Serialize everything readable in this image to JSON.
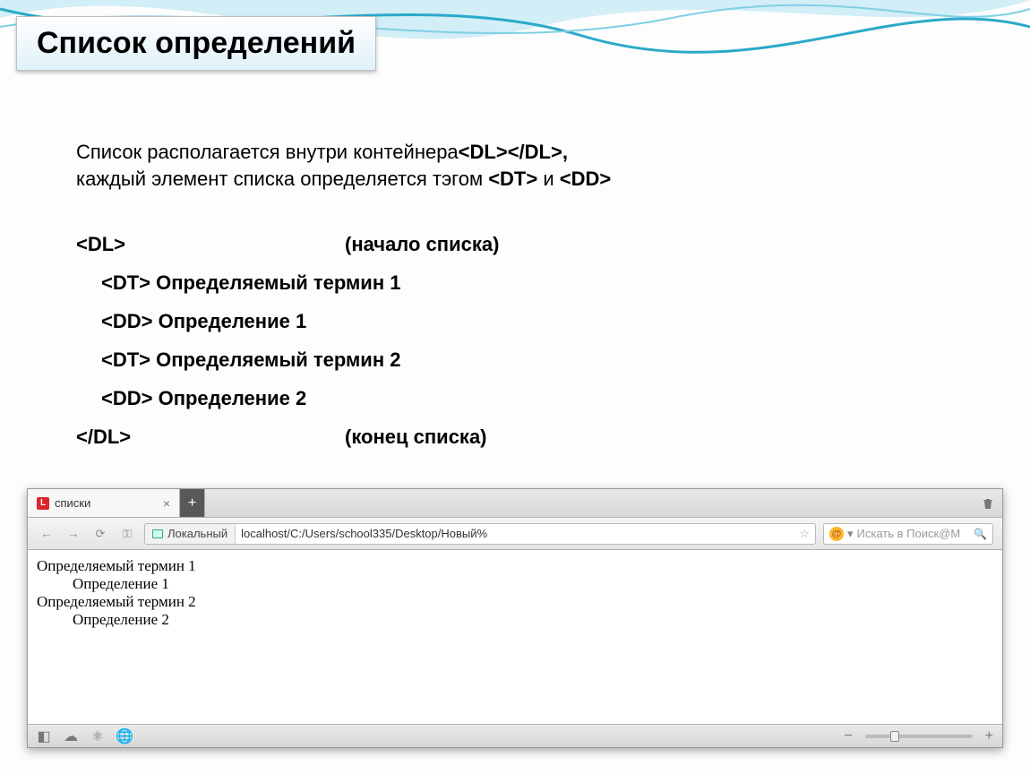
{
  "title": "Список определений",
  "intro": {
    "line1_a": "Список располагается внутри контейнера",
    "line1_b": "<DL></DL>,",
    "line2_a": "каждый элемент списка определяется тэгом ",
    "line2_b": "<DT>",
    "line2_c": " и ",
    "line2_d": "<DD>"
  },
  "code": {
    "r1a": "<DL>",
    "r1b": "(начало списка)",
    "r2": "<DT> Определяемый термин 1",
    "r3": "<DD> Определение 1",
    "r4": "<DT> Определяемый термин 2",
    "r5": "<DD> Определение 2",
    "r6a": "</DL>",
    "r6b": "(конец списка)"
  },
  "browser": {
    "tab_title": "списки",
    "tab_favicon": "L",
    "close_x": "×",
    "newtab": "+",
    "local_label": "Локальный",
    "url": "localhost/C:/Users/school335/Desktop/Новый%",
    "star": "☆",
    "search_placeholder": "Искать в Поиск@М",
    "search_dropdown": "▾",
    "search_glass": "🔍",
    "at": "@"
  },
  "rendered": {
    "dt1": "Определяемый термин 1",
    "dd1": "Определение 1",
    "dt2": "Определяемый термин 2",
    "dd2": "Определение 2"
  },
  "status": {
    "panel": "◧",
    "cloud": "☁",
    "share": "⚛",
    "world": "🌐",
    "minus": "−",
    "plus": "+"
  }
}
